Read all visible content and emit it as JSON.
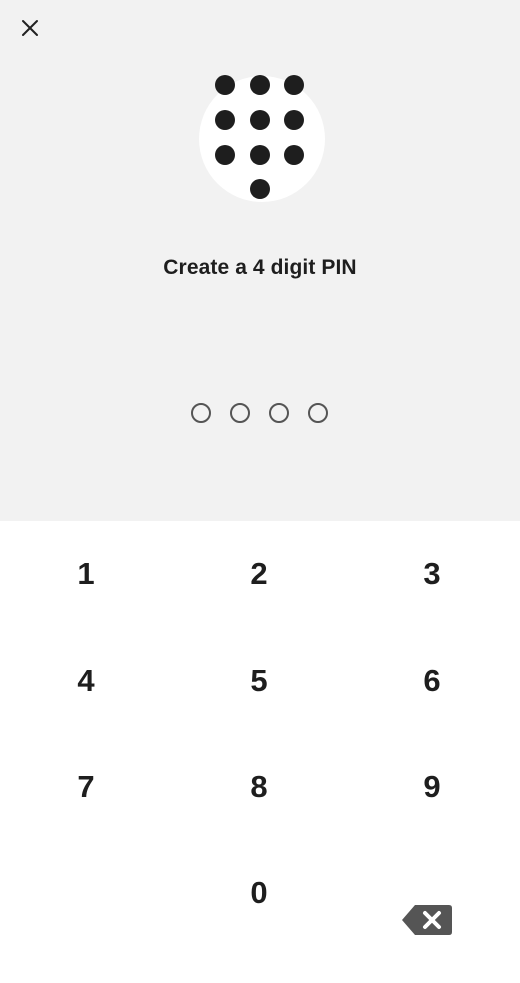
{
  "header": {
    "close_icon": "close-icon"
  },
  "illustration": {
    "icon": "keypad-dots-icon"
  },
  "title": "Create a 4 digit PIN",
  "pin": {
    "length": 4,
    "entered": 0
  },
  "keypad": {
    "keys": [
      "1",
      "2",
      "3",
      "4",
      "5",
      "6",
      "7",
      "8",
      "9",
      "0"
    ],
    "backspace_icon": "backspace-icon"
  },
  "colors": {
    "top_background": "#f2f2f2",
    "keypad_background": "#ffffff",
    "text": "#1e1e1e",
    "dot_outline": "#555555",
    "backspace": "#555555"
  }
}
